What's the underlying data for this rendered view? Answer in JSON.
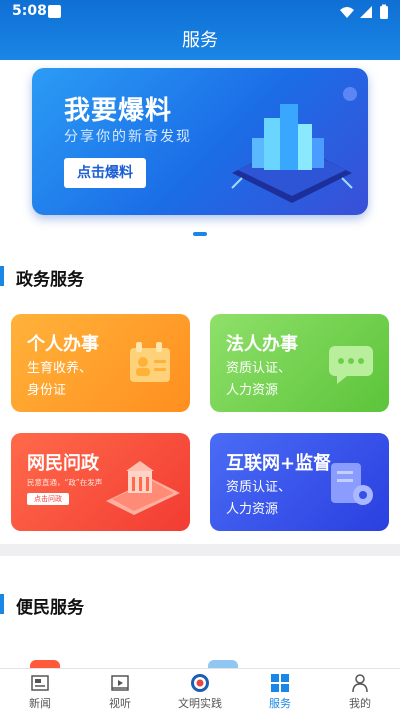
{
  "status_bar": {
    "time": "5:08"
  },
  "header": {
    "title": "服务"
  },
  "banner": {
    "title": "我要爆料",
    "subtitle": "分享你的新奇发现",
    "button_label": "点击爆料"
  },
  "gov_section": {
    "title": "政务服务",
    "cards": [
      {
        "title": "个人办事",
        "subtitle": "生育收养、\n身份证",
        "color": "#ff9a24"
      },
      {
        "title": "法人办事",
        "subtitle": "资质认证、\n人力资源",
        "color": "#6fcf4a"
      },
      {
        "title": "网民问政",
        "tagline": "民意直通，“政”在发声",
        "button_label": "点击问政",
        "color": "#f5473a"
      },
      {
        "title": "互联网+监督",
        "subtitle": "资质认证、\n人力资源",
        "color": "#3450e8"
      }
    ]
  },
  "conv_section": {
    "title": "便民服务"
  },
  "bottom_nav": {
    "items": [
      {
        "label": "新闻",
        "icon": "news-icon"
      },
      {
        "label": "视听",
        "icon": "video-icon"
      },
      {
        "label": "文明实践",
        "icon": "civilization-icon"
      },
      {
        "label": "服务",
        "icon": "service-grid-icon",
        "active": true
      },
      {
        "label": "我的",
        "icon": "profile-icon"
      }
    ]
  },
  "colors": {
    "accent": "#1a86e6"
  }
}
